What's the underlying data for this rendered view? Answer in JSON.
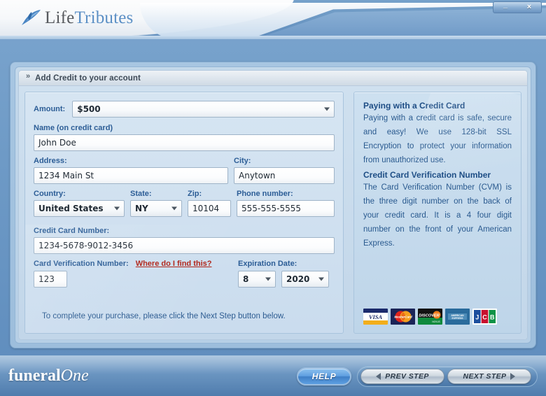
{
  "window": {
    "minimize_label": "_",
    "close_label": "×"
  },
  "brand": {
    "logo_word1": "Life",
    "logo_word2": "Tributes",
    "bird_icon": "bird-swoosh-icon"
  },
  "panel": {
    "chevron": "»",
    "title": "Add Credit to your account"
  },
  "form": {
    "amount": {
      "label": "Amount:",
      "value": "$500"
    },
    "name": {
      "label": "Name (on credit card)",
      "value": "John Doe"
    },
    "address": {
      "label": "Address:",
      "value": "1234 Main St"
    },
    "city": {
      "label": "City:",
      "value": "Anytown"
    },
    "country": {
      "label": "Country:",
      "value": "United States"
    },
    "state": {
      "label": "State:",
      "value": "NY"
    },
    "zip": {
      "label": "Zip:",
      "value": "10104"
    },
    "phone": {
      "label": "Phone number:",
      "value": "555-555-5555"
    },
    "card_number": {
      "label": "Credit Card Number:",
      "value": "1234-5678-9012-3456"
    },
    "cvm": {
      "label": "Card Verification Number:",
      "value": "123",
      "help_link": "Where do I find this?"
    },
    "expiration": {
      "label": "Expiration Date:",
      "month": "8",
      "year": "2020"
    },
    "note": "To complete your purchase, please click the Next Step button below."
  },
  "info": {
    "heading1": "Paying with a Credit Card",
    "paragraph1": "Paying with a credit card is safe, secure and easy! We use 128-bit SSL Encryption to protect your information from unauthorized use.",
    "heading2": "Credit Card Verification Number",
    "paragraph2": "The Card Verification Number (CVM) is the three digit number on the back of your credit card. It is a 4 four digit number on the front of your American Express.",
    "cards": [
      {
        "name": "visa-card-logo",
        "label": "VISA"
      },
      {
        "name": "mastercard-card-logo",
        "label": "MasterCard"
      },
      {
        "name": "discover-card-logo",
        "label": "DISCOVER"
      },
      {
        "name": "amex-card-logo",
        "label": "AMERICAN EXPRESS"
      },
      {
        "name": "jcb-card-logo",
        "label": "JCB"
      }
    ]
  },
  "footer": {
    "brand_part1": "funeral",
    "brand_part2": "One",
    "help_label": "HELP",
    "prev_label": "PREV STEP",
    "next_label": "NEXT STEP"
  },
  "colors": {
    "accent_blue": "#2c5d96",
    "link_red": "#b02418",
    "window_blue": "#6e9ac6",
    "panel_blue": "#cfe0ef"
  }
}
